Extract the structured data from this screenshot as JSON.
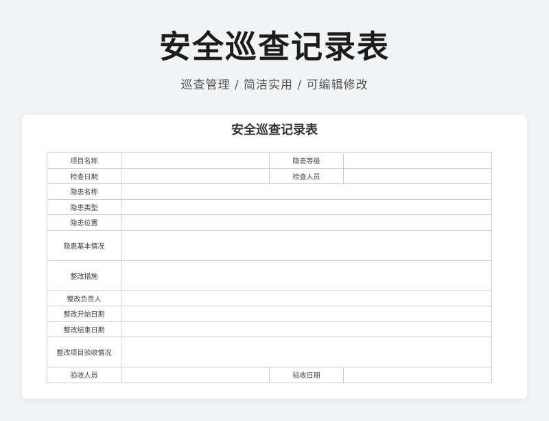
{
  "header": {
    "title": "安全巡查记录表",
    "subtitle": "巡查管理 / 简洁实用 /  可编辑修改"
  },
  "form": {
    "title": "安全巡查记录表",
    "rows": {
      "project_name": "项目名称",
      "hazard_level": "隐患等级",
      "inspection_date": "检查日期",
      "inspector": "检查人员",
      "hazard_name": "隐患名称",
      "hazard_type": "隐患类型",
      "hazard_location": "隐患位置",
      "hazard_basic_info": "隐患基本情况",
      "rectification_measures": "整改措施",
      "rectification_owner": "整改负责人",
      "rectification_start_date": "整改开始日期",
      "rectification_end_date": "整改结束日期",
      "acceptance_status": "整改项目验收情况",
      "acceptance_person": "验收人员",
      "acceptance_date": "验收日期"
    }
  }
}
